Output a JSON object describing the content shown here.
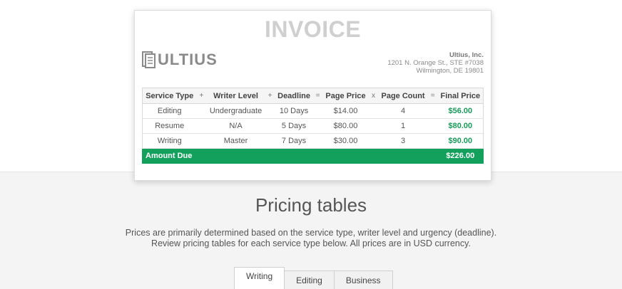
{
  "invoice": {
    "title": "INVOICE",
    "logo_text": "ULTIUS",
    "company": {
      "name": "Ultius, Inc.",
      "address1": "1201 N. Orange St., STE #7038",
      "address2": "Wilmington, DE 19801"
    },
    "columns": [
      "Service Type",
      "Writer Level",
      "Deadline",
      "Page Price",
      "Page Count",
      "Final Price"
    ],
    "operators": [
      "+",
      "+",
      "=",
      "x",
      "="
    ],
    "rows": [
      {
        "service": "Editing",
        "level": "Undergraduate",
        "deadline": "10 Days",
        "price": "$14.00",
        "count": "4",
        "final": "$56.00"
      },
      {
        "service": "Resume",
        "level": "N/A",
        "deadline": "5 Days",
        "price": "$80.00",
        "count": "1",
        "final": "$80.00"
      },
      {
        "service": "Writing",
        "level": "Master",
        "deadline": "7 Days",
        "price": "$30.00",
        "count": "3",
        "final": "$90.00"
      }
    ],
    "amount_due_label": "Amount Due",
    "amount_due_value": "$226.00",
    "colors": {
      "accent": "#13a05c",
      "final_text": "#1a9a5a"
    }
  },
  "pricing": {
    "title": "Pricing tables",
    "desc_line1": "Prices are primarily determined based on the service type, writer level and urgency (deadline).",
    "desc_line2": "Review pricing tables for each service type below. All prices are in USD currency.",
    "tabs": [
      {
        "label": "Writing",
        "active": true
      },
      {
        "label": "Editing",
        "active": false
      },
      {
        "label": "Business",
        "active": false
      }
    ]
  }
}
